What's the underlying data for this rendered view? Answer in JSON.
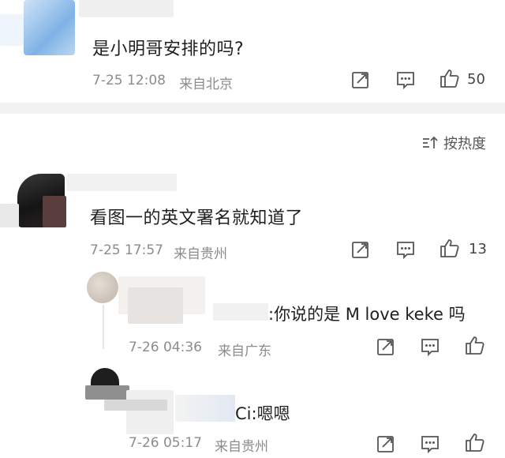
{
  "comments": [
    {
      "text": "是小明哥安排的吗?",
      "date": "7-25 12:08",
      "location": "来自北京",
      "likes": "50"
    },
    {
      "text": "看图一的英文署名就知道了",
      "date": "7-25 17:57",
      "location": "来自贵州",
      "likes": "13"
    }
  ],
  "sort": {
    "label": "按热度"
  },
  "replies": [
    {
      "text": ":你说的是 M love keke 吗",
      "date": "7-26 04:36",
      "location": "来自广东"
    },
    {
      "text": "Ci:嗯嗯",
      "date": "7-26 05:17",
      "location": "来自贵州"
    }
  ],
  "icons": {
    "share": "share-icon",
    "comment": "comment-icon",
    "like": "thumbs-up-icon",
    "sort": "sort-icon"
  },
  "colors": {
    "text": "#1f1f1f",
    "meta": "#8c8c8c",
    "icon": "#555555",
    "divider": "#f2f2f2"
  }
}
